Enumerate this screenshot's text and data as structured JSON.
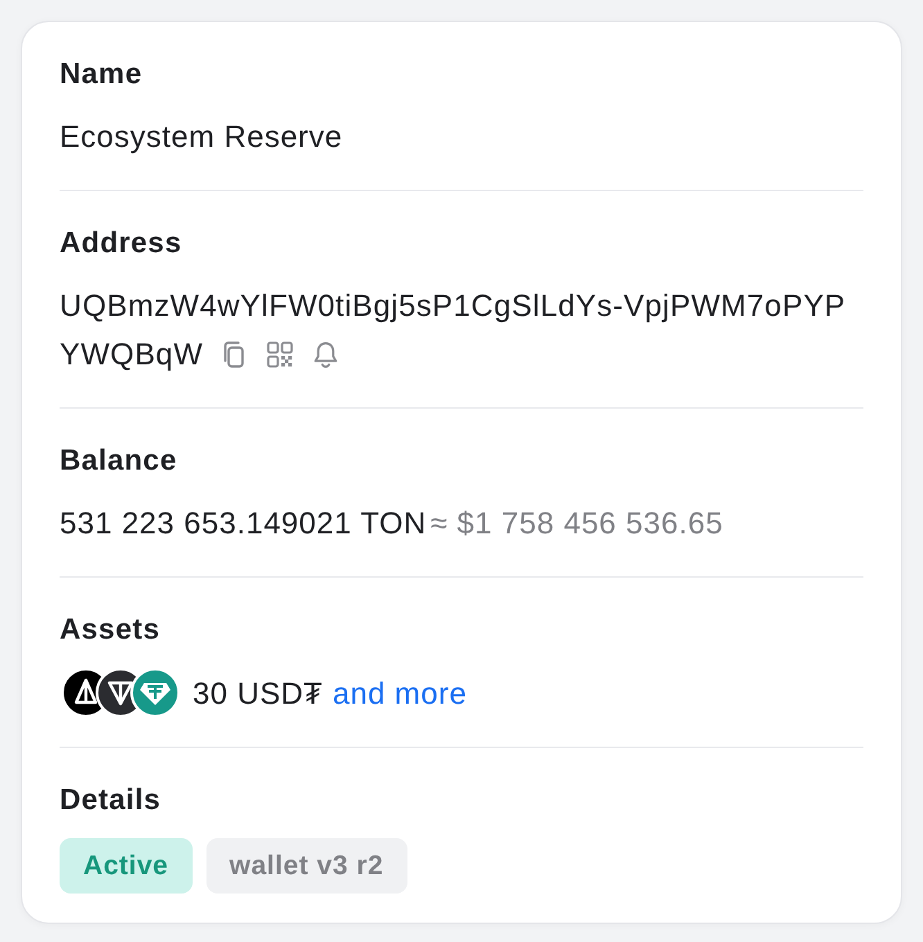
{
  "sections": [
    {
      "kind": "text",
      "label": "Name",
      "value": "Ecosystem Reserve"
    },
    {
      "kind": "address",
      "label": "Address",
      "lines": [
        "UQBmzW4wYlFW0tiBgj5sP1CgSlLdYs-VpjPWM7oPYP",
        "YWQBqW"
      ]
    },
    {
      "kind": "balance",
      "label": "Balance",
      "amount": "531 223 653.149021 TON",
      "fiat": "≈ $1 758 456 536.65"
    },
    {
      "kind": "assets",
      "label": "Assets",
      "tokens": [
        {
          "color": "#000000"
        },
        {
          "color": "#2b2c30"
        },
        {
          "color": "#17998a"
        }
      ],
      "summary": "30 USD₮",
      "link": "and more"
    },
    {
      "kind": "badges",
      "label": "Details",
      "badges": [
        {
          "kind": "status",
          "label": "Active"
        },
        {
          "kind": "type",
          "label": "wallet v3 r2"
        }
      ]
    }
  ]
}
